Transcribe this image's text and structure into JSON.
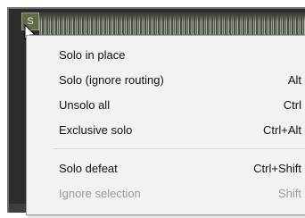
{
  "track": {
    "solo_label": "S"
  },
  "menu": {
    "items": [
      {
        "label": "Solo in place",
        "shortcut": "",
        "enabled": true
      },
      {
        "label": "Solo (ignore routing)",
        "shortcut": "Alt",
        "enabled": true
      },
      {
        "label": "Unsolo all",
        "shortcut": "Ctrl",
        "enabled": true
      },
      {
        "label": "Exclusive solo",
        "shortcut": "Ctrl+Alt",
        "enabled": true
      },
      {
        "label": "Solo defeat",
        "shortcut": "Ctrl+Shift",
        "enabled": true
      },
      {
        "label": "Ignore selection",
        "shortcut": "Shift",
        "enabled": false
      }
    ]
  },
  "colors": {
    "menu_background": "#f2f2f2",
    "disabled_text": "#9a9a9a",
    "solo_button": "#5f6a4a"
  }
}
